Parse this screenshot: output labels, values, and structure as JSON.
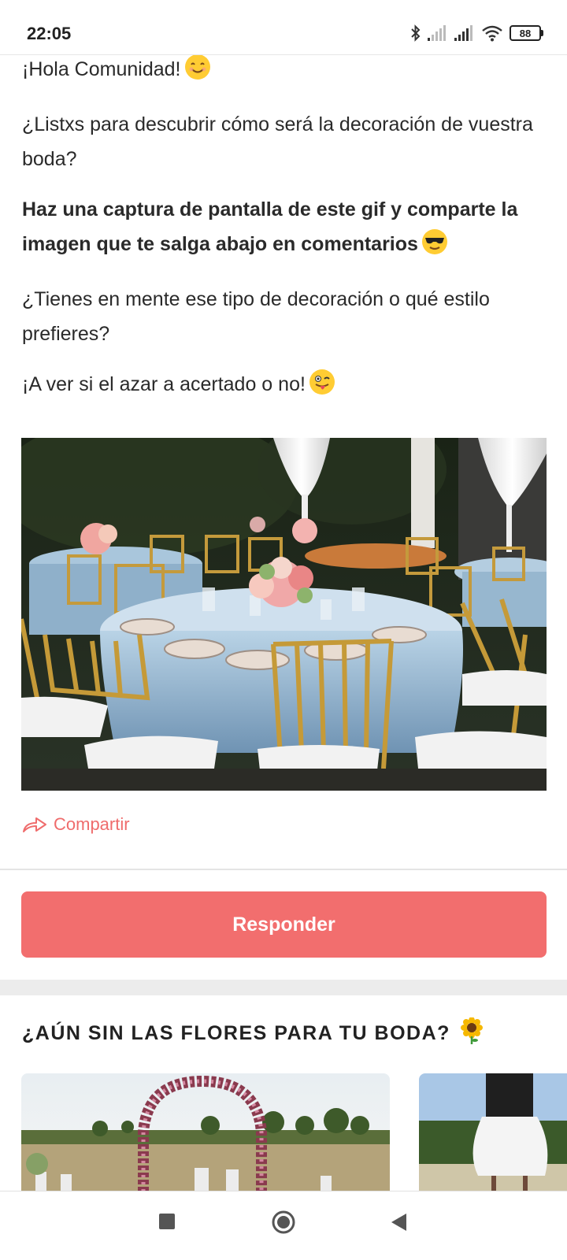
{
  "status_bar": {
    "time": "22:05",
    "battery_level": "88",
    "icons": [
      "bluetooth-icon",
      "signal-icon",
      "signal-icon",
      "wifi-icon",
      "battery-icon"
    ]
  },
  "post": {
    "greeting": "¡Hola Comunidad!",
    "question": "¿Listxs para descubrir cómo será la decoración de vuestra boda?",
    "instruction": "Haz una captura de pantalla de este gif y comparte la imagen que te salga abajo en comentarios",
    "style_question": "¿Tienes en mente ese tipo de decoración o qué estilo prefieres?",
    "closing": "¡A ver si el azar a acertado o no!",
    "emojis": [
      "smiling-face-emoji",
      "sunglasses-face-emoji",
      "winking-tongue-face-emoji"
    ]
  },
  "actions": {
    "share_label": "Compartir",
    "reply_label": "Responder"
  },
  "promo": {
    "title": "¿AÚN SIN LAS FLORES PARA TU BODA?",
    "title_icon": "sunflower-emoji"
  },
  "navbar": {
    "icons": [
      "recent-apps-icon",
      "home-icon",
      "back-icon"
    ]
  },
  "colors": {
    "accent": "#f26e6e",
    "text": "#2a2a2a"
  }
}
